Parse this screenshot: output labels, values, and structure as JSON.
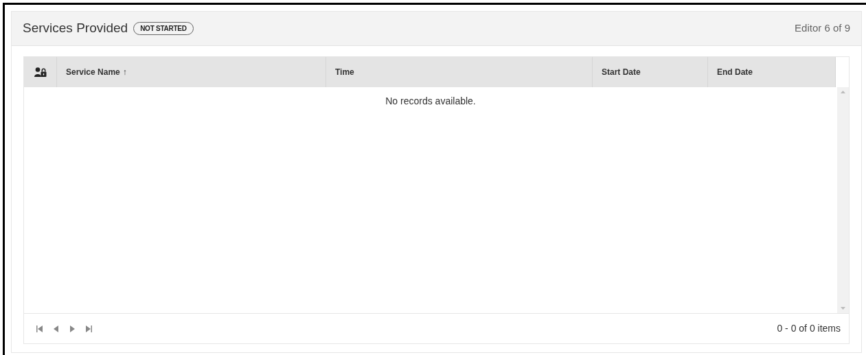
{
  "header": {
    "title": "Services Provided",
    "status_badge": "NOT STARTED",
    "editor_position": "Editor 6 of 9"
  },
  "table": {
    "columns": [
      {
        "kind": "icon"
      },
      {
        "kind": "text",
        "label": "Service Name",
        "sort_indicator": "↑"
      },
      {
        "kind": "text",
        "label": "Time"
      },
      {
        "kind": "text",
        "label": "Start Date"
      },
      {
        "kind": "text",
        "label": "End Date"
      }
    ],
    "empty_message": "No records available."
  },
  "pager": {
    "summary": "0 - 0 of 0 items"
  }
}
